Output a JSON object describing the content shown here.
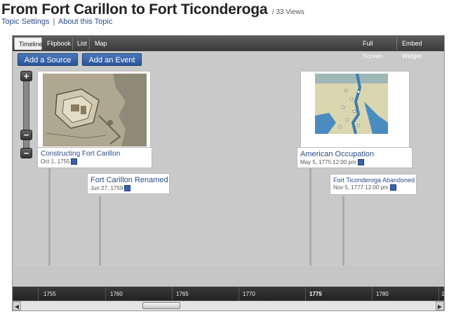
{
  "page": {
    "title": "From Fort Carillon to Fort Ticonderoga",
    "views": "/ 33 Views",
    "links": [
      {
        "label": "Topic Settings"
      },
      {
        "label": "About this Topic"
      }
    ],
    "link_separator": "|"
  },
  "tabs": {
    "left": [
      "Timeline",
      "Flipbook",
      "List",
      "Map"
    ],
    "active": "Timeline",
    "right": [
      "Full Screen",
      "Embed Widget"
    ]
  },
  "actions": {
    "add_source": "Add a Source",
    "add_event": "Add an Event"
  },
  "zoom": {
    "plus": "+",
    "minus": "−",
    "minus_bottom": "−"
  },
  "events": [
    {
      "title": "Constructing Fort Carillon",
      "date": "Oct 1, 1755",
      "image": "fort-plan-map"
    },
    {
      "title": "Fort Carillon Renamed",
      "date": "Jun 27, 1759"
    },
    {
      "title": "American Occupation",
      "date": "May 5, 1775 12:00 pm",
      "image": "lake-champlain-map"
    },
    {
      "title": "Fort Ticonderoga Abandoned",
      "date": "Nov 5, 1777 12:00 pm"
    }
  ],
  "axis": {
    "ticks": [
      "1755",
      "1760",
      "1765",
      "1770",
      "1775",
      "1780",
      "1"
    ],
    "current": "1775"
  },
  "scrollbar": {
    "left_arrow": "◀",
    "right_arrow": "▶"
  },
  "colors": {
    "accent": "#2b5597",
    "link": "#2a4d88",
    "panel_bg": "#c9c9c9",
    "bar_dark": "#3a3a3a"
  }
}
